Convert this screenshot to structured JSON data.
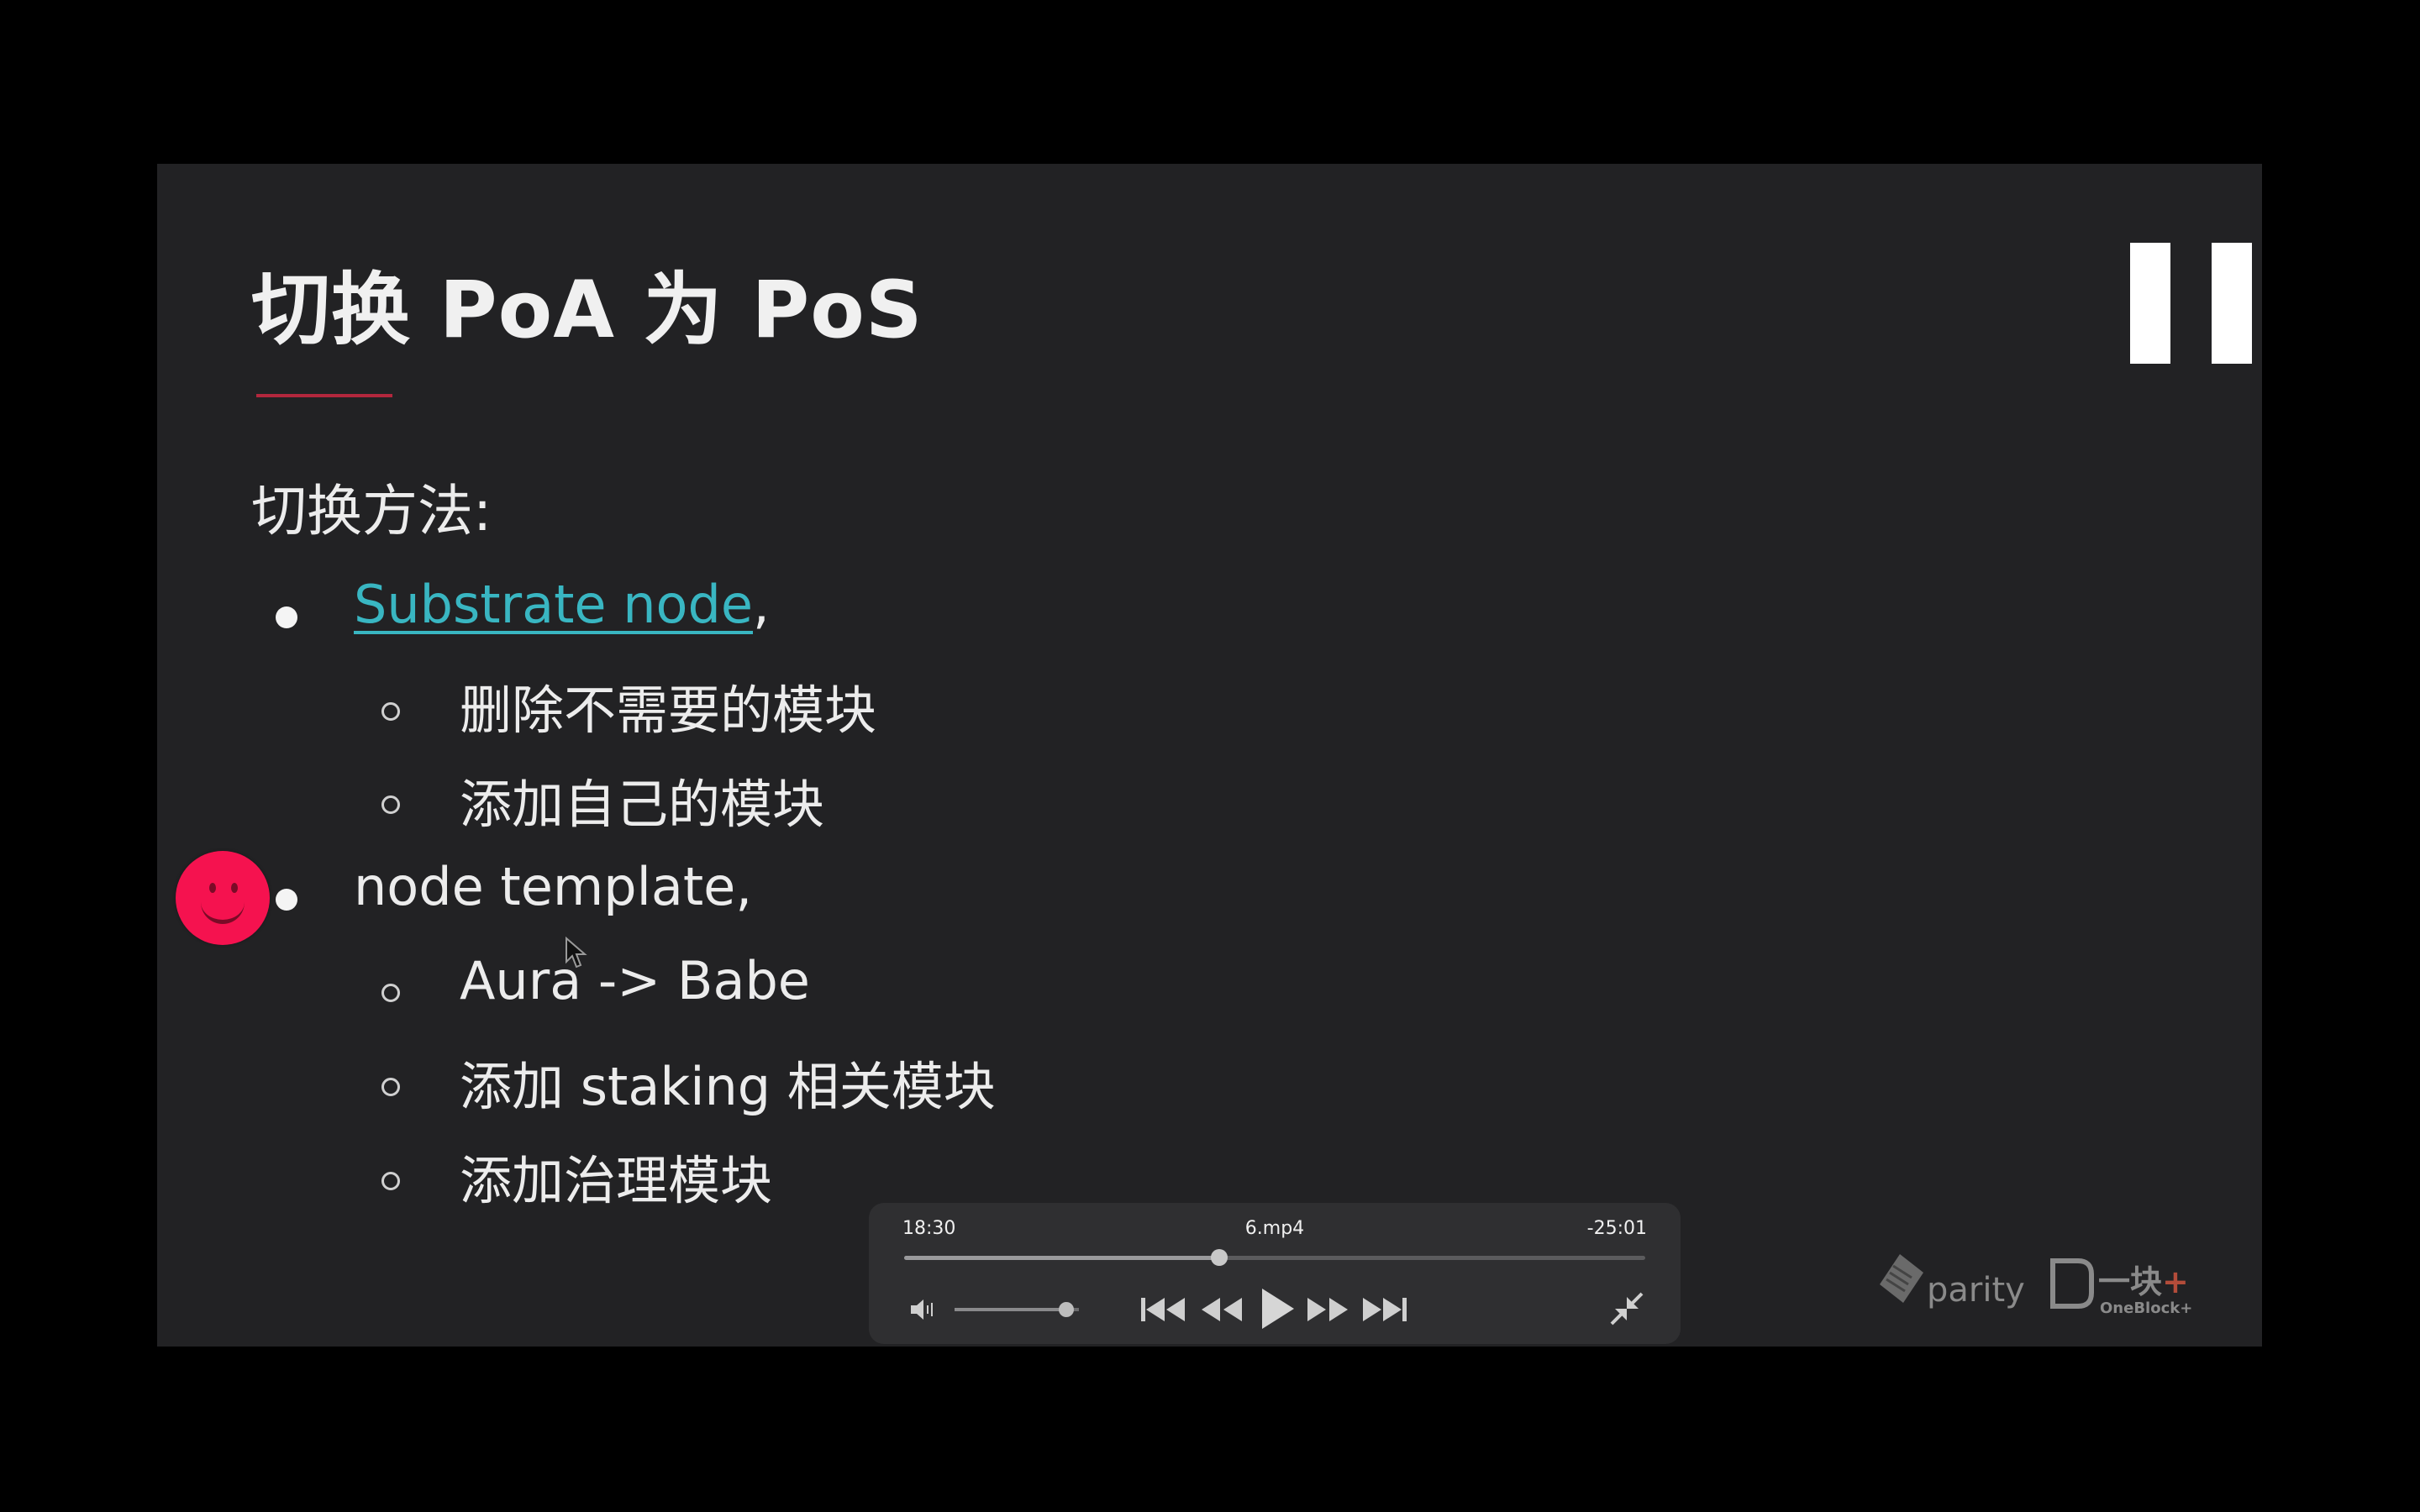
{
  "slide": {
    "title": "切换 PoA 为 PoS",
    "heading": "切换方法:",
    "items": [
      {
        "link_text": "Substrate node",
        "suffix": ","
      },
      {
        "text": "删除不需要的模块"
      },
      {
        "text": "添加自己的模块"
      },
      {
        "text": "node template,"
      },
      {
        "text": "Aura -> Babe"
      },
      {
        "text": "添加 staking 相关模块"
      },
      {
        "text": "添加治理模块"
      }
    ],
    "logos": {
      "parity": "parity",
      "oneblock_cn": "一块",
      "oneblock_plus": "+",
      "oneblock_en": "OneBlock+"
    }
  },
  "player": {
    "elapsed": "18:30",
    "filename": "6.mp4",
    "remaining": "-25:01",
    "progress_fraction": 0.425,
    "volume_fraction": 0.9,
    "state": "paused"
  },
  "colors": {
    "background": "#000000",
    "slide": "#222224",
    "link": "#39b6c2",
    "accent_rule": "#b3273d",
    "smiley": "#f5124f"
  },
  "icons": {
    "pause": "pause-icon",
    "volume": "volume-icon",
    "skip_back": "skip-back-icon",
    "rewind": "rewind-icon",
    "play": "play-icon",
    "fast_forward": "fast-forward-icon",
    "skip_forward": "skip-forward-icon",
    "exit_fullscreen": "exit-fullscreen-icon",
    "cursor": "cursor-icon",
    "smiley": "smiley-icon"
  }
}
